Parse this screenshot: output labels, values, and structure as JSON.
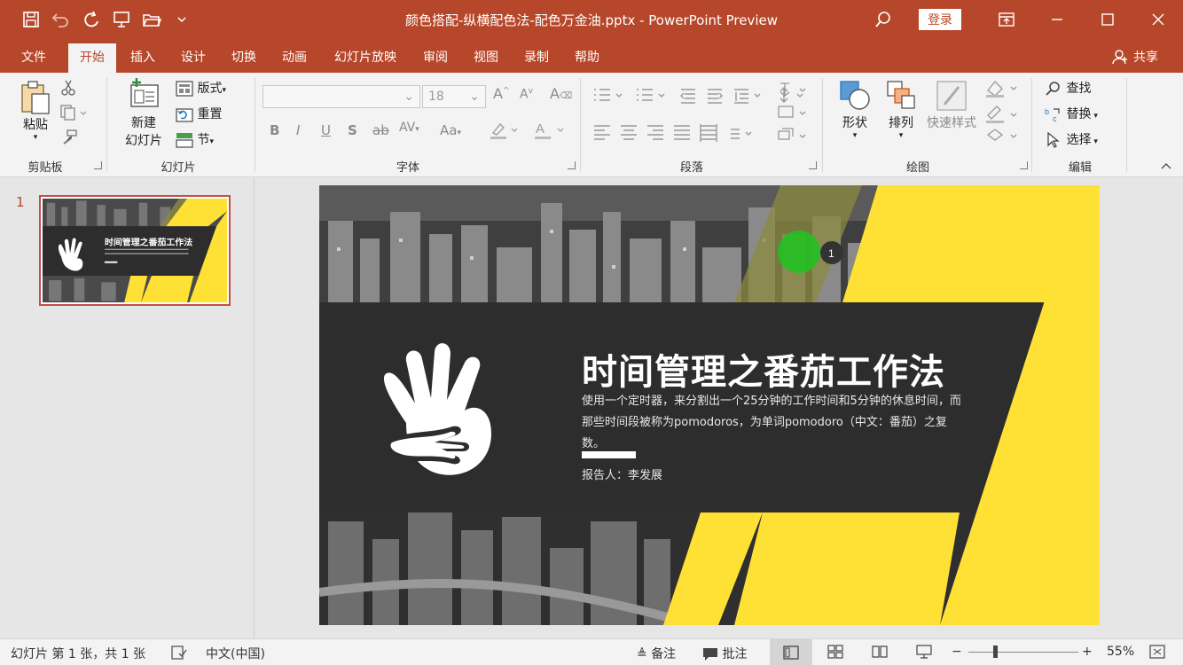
{
  "window": {
    "title": "颜色搭配-纵横配色法-配色万金油.pptx  -  PowerPoint Preview",
    "login_label": "登录",
    "accent": "#b7472a"
  },
  "tabs": [
    {
      "label": "文件"
    },
    {
      "label": "开始"
    },
    {
      "label": "插入"
    },
    {
      "label": "设计"
    },
    {
      "label": "切换"
    },
    {
      "label": "动画"
    },
    {
      "label": "幻灯片放映"
    },
    {
      "label": "审阅"
    },
    {
      "label": "视图"
    },
    {
      "label": "录制"
    },
    {
      "label": "帮助"
    }
  ],
  "active_tab": "开始",
  "share_label": "共享",
  "ribbon": {
    "clipboard": {
      "paste": "粘贴",
      "label": "剪贴板"
    },
    "slides": {
      "new_slide_line1": "新建",
      "new_slide_line2": "幻灯片",
      "layout": "版式",
      "reset": "重置",
      "section": "节",
      "label": "幻灯片"
    },
    "font": {
      "size": "18",
      "label": "字体"
    },
    "paragraph": {
      "label": "段落"
    },
    "drawing": {
      "shapes": "形状",
      "arrange": "排列",
      "quick_styles": "快速样式",
      "label": "绘图"
    },
    "editing": {
      "find": "查找",
      "replace": "替换",
      "select": "选择",
      "label": "编辑"
    }
  },
  "slide_panel": {
    "number": "1"
  },
  "slide": {
    "title": "时间管理之番茄工作法",
    "body": "使用一个定时器，来分割出一个25分钟的工作时间和5分钟的休息时间，而那些时间段被称为pomodoros，为单词pomodoro（中文：番茄）之复数。",
    "reporter": "报告人：李发展",
    "badge_number": "1",
    "colors": {
      "yellow": "#ffe135",
      "band": "#2d2d2d",
      "green": "#22c022"
    }
  },
  "statusbar": {
    "slide_info": "幻灯片 第 1 张，共 1 张",
    "language": "中文(中国)",
    "notes": "备注",
    "comments": "批注",
    "zoom": "55%"
  }
}
